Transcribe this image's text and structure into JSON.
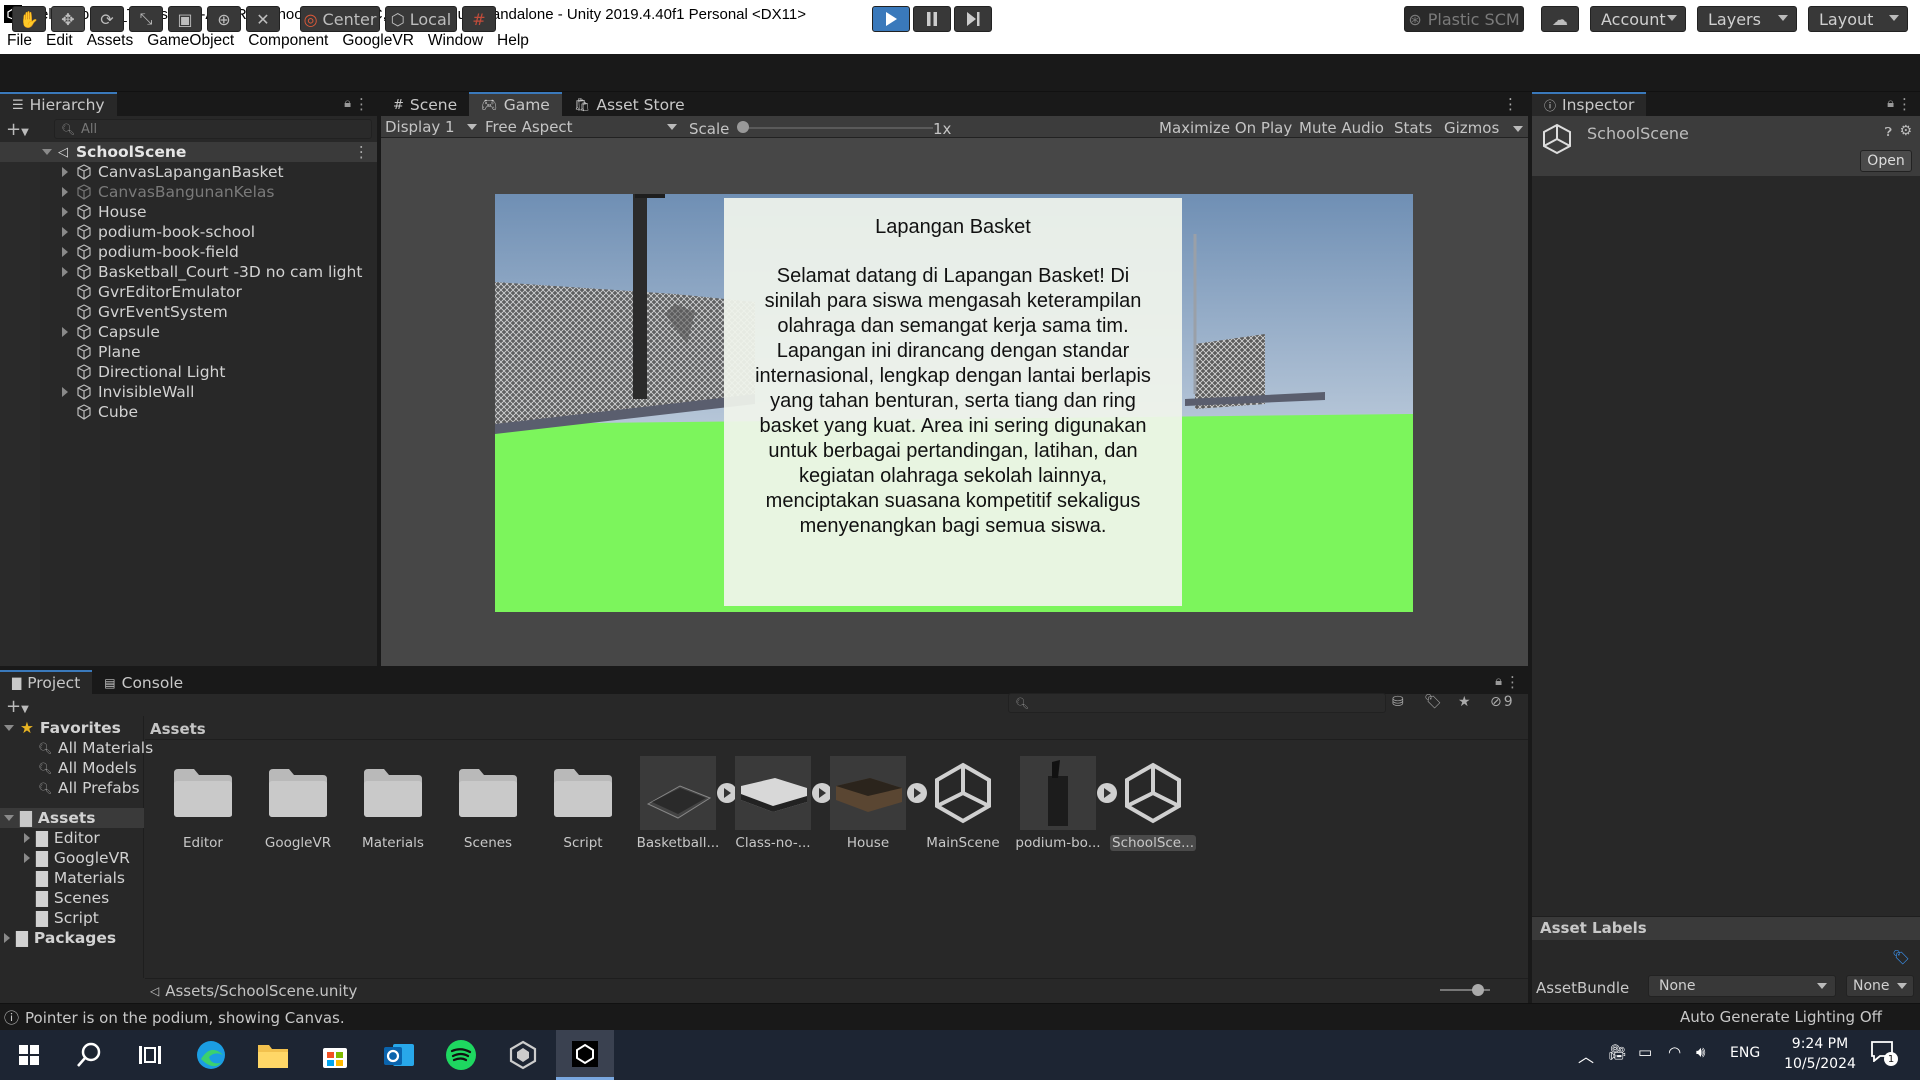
{
  "window": {
    "title": "Kelompok-24_Tugas-MID-ARVR - SchoolScene - PC, Mac & Linux Standalone - Unity 2019.4.40f1 Personal <DX11>",
    "minimize": "—",
    "maximize": "❐",
    "close": "✕"
  },
  "menu": [
    "File",
    "Edit",
    "Assets",
    "GameObject",
    "Component",
    "GoogleVR",
    "Window",
    "Help"
  ],
  "toolbar": {
    "pivot": "Center",
    "space": "Local",
    "plastic": "Plastic SCM",
    "account": "Account",
    "layers": "Layers",
    "layout": "Layout"
  },
  "hierarchy": {
    "tab": "Hierarchy",
    "search_placeholder": "All",
    "scene": "SchoolScene",
    "items": [
      {
        "label": "CanvasLapanganBasket",
        "expandable": true,
        "dim": false
      },
      {
        "label": "CanvasBangunanKelas",
        "expandable": true,
        "dim": true
      },
      {
        "label": "House",
        "expandable": true,
        "dim": false
      },
      {
        "label": "podium-book-school",
        "expandable": true,
        "dim": false
      },
      {
        "label": "podium-book-field",
        "expandable": true,
        "dim": false
      },
      {
        "label": "Basketball_Court -3D no cam light",
        "expandable": true,
        "dim": false
      },
      {
        "label": "GvrEditorEmulator",
        "expandable": false,
        "dim": false
      },
      {
        "label": "GvrEventSystem",
        "expandable": false,
        "dim": false
      },
      {
        "label": "Capsule",
        "expandable": true,
        "dim": false
      },
      {
        "label": "Plane",
        "expandable": false,
        "dim": false
      },
      {
        "label": "Directional Light",
        "expandable": false,
        "dim": false
      },
      {
        "label": "InvisibleWall",
        "expandable": true,
        "dim": false
      },
      {
        "label": "Cube",
        "expandable": false,
        "dim": false
      }
    ]
  },
  "center_tabs": [
    "Scene",
    "Game",
    "Asset Store"
  ],
  "game_bar": {
    "display": "Display 1",
    "aspect": "Free Aspect",
    "scale_label": "Scale",
    "scale_value": "1x",
    "maximize": "Maximize On Play",
    "mute": "Mute Audio",
    "stats": "Stats",
    "gizmos": "Gizmos"
  },
  "game_canvas": {
    "title": "Lapangan Basket",
    "body": "Selamat datang di Lapangan Basket! Di sinilah para siswa mengasah keterampilan olahraga dan semangat kerja sama tim. Lapangan ini dirancang dengan standar internasional, lengkap dengan lantai berlapis yang tahan benturan, serta tiang dan ring basket yang kuat. Area ini sering digunakan untuk berbagai pertandingan, latihan, dan kegiatan olahraga sekolah lainnya, menciptakan suasana kompetitif sekaligus menyenangkan bagi semua siswa."
  },
  "inspector": {
    "tab": "Inspector",
    "object": "SchoolScene",
    "open": "Open",
    "asset_labels": "Asset Labels",
    "assetbundle_label": "AssetBundle",
    "assetbundle_value": "None",
    "variant_value": "None"
  },
  "project": {
    "tabs": [
      "Project",
      "Console"
    ],
    "hidden_count": "9",
    "favorites_label": "Favorites",
    "favorites": [
      "All Materials",
      "All Models",
      "All Prefabs"
    ],
    "assets_label": "Assets",
    "asset_folders": [
      "Editor",
      "GoogleVR",
      "Materials",
      "Scenes",
      "Script"
    ],
    "packages_label": "Packages",
    "breadcrumb": "Assets",
    "assets": [
      {
        "label": "Editor",
        "kind": "folder"
      },
      {
        "label": "GoogleVR",
        "kind": "folder"
      },
      {
        "label": "Materials",
        "kind": "folder"
      },
      {
        "label": "Scenes",
        "kind": "folder"
      },
      {
        "label": "Script",
        "kind": "folder"
      },
      {
        "label": "Basketball...",
        "kind": "model"
      },
      {
        "label": "Class-no-...",
        "kind": "model"
      },
      {
        "label": "House",
        "kind": "model"
      },
      {
        "label": "MainScene",
        "kind": "scene"
      },
      {
        "label": "podium-bo...",
        "kind": "model"
      },
      {
        "label": "SchoolSce...",
        "kind": "scene"
      }
    ],
    "path": "Assets/SchoolScene.unity"
  },
  "status": {
    "message": "Pointer is on the podium, showing Canvas.",
    "lighting": "Auto Generate Lighting Off"
  },
  "taskbar": {
    "lang": "ENG",
    "time": "9:24 PM",
    "date": "10/5/2024",
    "notif_count": "1"
  },
  "colors": {
    "accent": "#3a79bb",
    "panel": "#282828",
    "ground": "#7cf55c",
    "sky": "#a9bfd6"
  }
}
